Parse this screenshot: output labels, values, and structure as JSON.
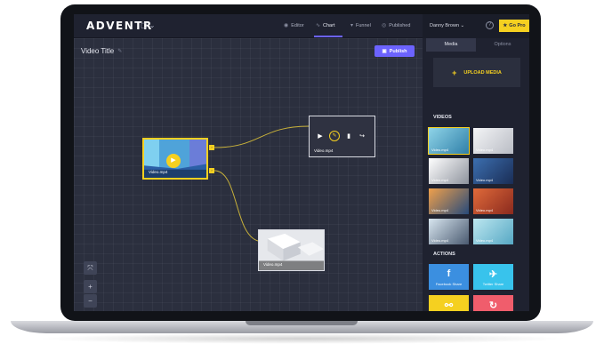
{
  "app": {
    "logo": "ADVENTR",
    "view_switch": "▢ ⌄"
  },
  "nav": {
    "items": [
      {
        "label": "Editor",
        "icon": "eye-icon"
      },
      {
        "label": "Chart",
        "icon": "chart-icon"
      },
      {
        "label": "Funnel",
        "icon": "funnel-icon"
      },
      {
        "label": "Published",
        "icon": "globe-icon"
      }
    ],
    "active": "Chart"
  },
  "user": {
    "name": "Danny Brown ⌄",
    "go_pro": "Go Pro"
  },
  "canvas": {
    "title": "Video Title",
    "publish": "Publish",
    "nodes": [
      {
        "label": "Video.mp4"
      },
      {
        "label": "Video.mp4"
      },
      {
        "label": "Video.mp4"
      }
    ]
  },
  "panel": {
    "tabs": [
      "Media",
      "Options"
    ],
    "upload": "UPLOAD MEDIA",
    "videos_heading": "VIDEOS",
    "videos": [
      {
        "label": "Video.mp4"
      },
      {
        "label": "Video.mp4"
      },
      {
        "label": "Video.mp4"
      },
      {
        "label": "Video.mp4"
      },
      {
        "label": "Video.mp4"
      },
      {
        "label": "Video.mp4"
      },
      {
        "label": "Video.mp4"
      },
      {
        "label": "Video.mp4"
      }
    ],
    "actions_heading": "ACTIONS",
    "actions": [
      {
        "label": "Facebook Share",
        "icon": "facebook-icon",
        "color": "#3b8fe0"
      },
      {
        "label": "Twitter Share",
        "icon": "twitter-icon",
        "color": "#38c3ec"
      },
      {
        "label": "",
        "icon": "link-icon",
        "color": "#f5d020"
      },
      {
        "label": "",
        "icon": "refresh-icon",
        "color": "#f05d6c"
      }
    ]
  },
  "colors": {
    "accent": "#6c63ff",
    "highlight": "#f5d020"
  }
}
